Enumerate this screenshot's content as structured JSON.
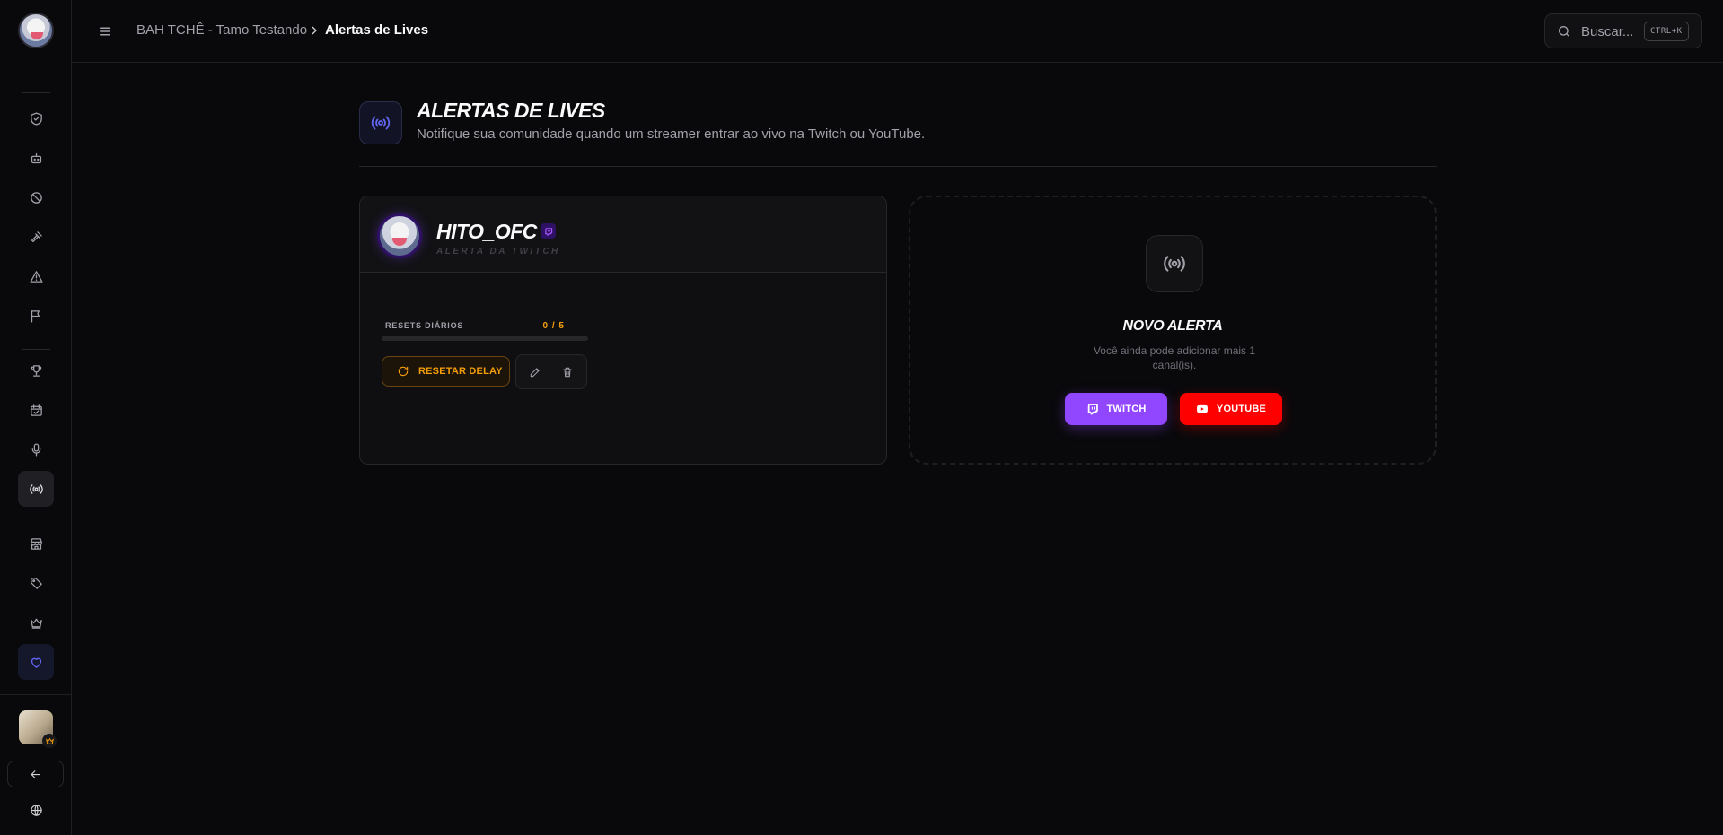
{
  "breadcrumb": {
    "server": "BAH TCHÊ - Tamo Testando",
    "current": "Alertas de Lives"
  },
  "search": {
    "placeholder": "Buscar...",
    "shortcut": "CTRL+K"
  },
  "page": {
    "title": "ALERTAS DE LIVES",
    "subtitle": "Notifique sua comunidade quando um streamer entrar ao vivo na Twitch ou YouTube."
  },
  "alert_card": {
    "streamer": "HITO_OFC",
    "platform_label": "ALERTA DA TWITCH",
    "resets_label": "RESETS DIÁRIOS",
    "resets_count": "0 / 5",
    "resets_used": 0,
    "resets_max": 5,
    "reset_button": "RESETAR DELAY"
  },
  "new_alert": {
    "title": "NOVO ALERTA",
    "description": "Você ainda pode adicionar mais 1 canal(is).",
    "twitch_button": "TWITCH",
    "youtube_button": "YOUTUBE"
  },
  "colors": {
    "accent": "#6366f1",
    "warning": "#f59e0b",
    "twitch": "#9146ff",
    "youtube": "#ff0000",
    "background": "#09090b"
  },
  "sidebar": {
    "icons": [
      "shield-check-icon",
      "bot-icon",
      "ban-icon",
      "gavel-icon",
      "warning-icon",
      "flag-icon",
      "trophy-icon",
      "calendar-check-icon",
      "microphone-icon",
      "radio-broadcast-icon",
      "store-icon",
      "tag-icon",
      "crown-icon",
      "heart-icon"
    ],
    "active": "radio-broadcast-icon"
  }
}
